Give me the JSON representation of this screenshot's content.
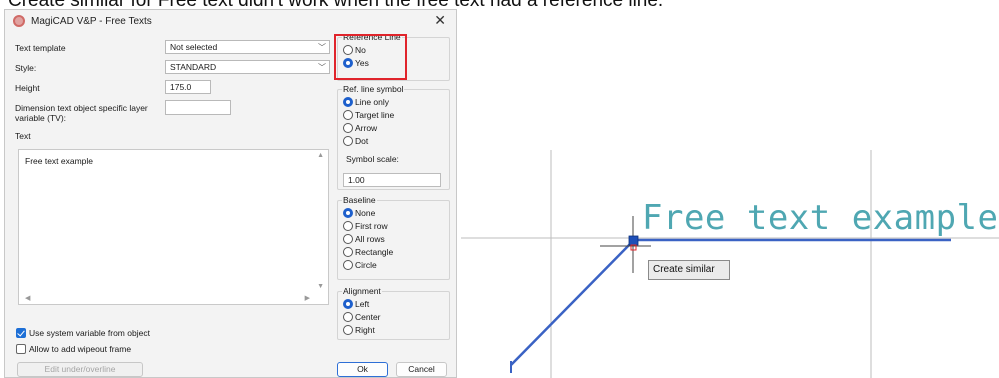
{
  "caption": "Create similar for Free text didn't work when the free text had a reference line.",
  "dialog": {
    "title": "MagiCAD V&P - Free Texts",
    "close_glyph": "✕",
    "fields": {
      "text_template_label": "Text template",
      "text_template_value": "Not selected",
      "style_label": "Style:",
      "style_value": "STANDARD",
      "height_label": "Height",
      "height_value": "175.0",
      "dimension_label_line1": "Dimension text object specific layer",
      "dimension_label_line2": "variable (TV):",
      "dimension_value": "",
      "text_label": "Text",
      "text_value": "Free text example"
    },
    "checkboxes": [
      {
        "label": "Use system variable from object",
        "checked": true
      },
      {
        "label": "Allow to add wipeout frame",
        "checked": false
      }
    ],
    "buttons": {
      "edit_under_overline": "Edit under/overline",
      "ok": "Ok",
      "cancel": "Cancel"
    },
    "reference_line": {
      "title": "Reference Line",
      "options": [
        "No",
        "Yes"
      ],
      "selected": "Yes"
    },
    "ref_line_symbol": {
      "title": "Ref. line symbol",
      "options": [
        "Line only",
        "Target line",
        "Arrow",
        "Dot"
      ],
      "selected": "Line only",
      "symbol_scale_label": "Symbol scale:",
      "symbol_scale_value": "1.00"
    },
    "baseline": {
      "title": "Baseline",
      "options": [
        "None",
        "First row",
        "All rows",
        "Rectangle",
        "Circle"
      ],
      "selected": "None"
    },
    "alignment": {
      "title": "Alignment",
      "options": [
        "Left",
        "Center",
        "Right"
      ],
      "selected": "Left"
    }
  },
  "cad": {
    "free_text": "Free text example",
    "tooltip": "Create similar",
    "colors": {
      "text": "#4fa7b2",
      "reference_line": "#3a62c4",
      "grid_line": "#bdbdbd",
      "grip": "#1e4fb8",
      "highlight_box": "#e0242b"
    }
  }
}
